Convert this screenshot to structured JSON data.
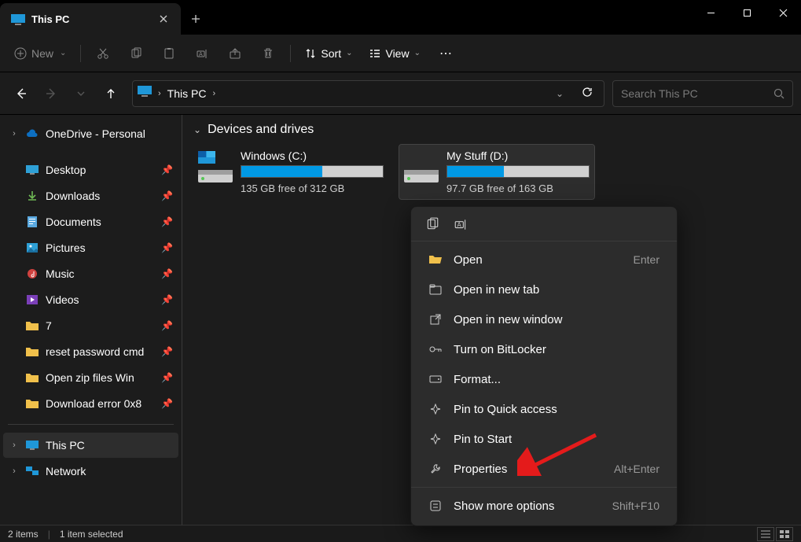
{
  "window": {
    "tab_title": "This PC",
    "search_placeholder": "Search This PC"
  },
  "toolbar": {
    "new_label": "New",
    "sort_label": "Sort",
    "view_label": "View"
  },
  "breadcrumb": {
    "item1": "This PC"
  },
  "sidebar": {
    "onedrive": "OneDrive - Personal",
    "items": [
      "Desktop",
      "Downloads",
      "Documents",
      "Pictures",
      "Music",
      "Videos",
      "7",
      "reset password cmd",
      "Open zip files Win",
      "Download error 0x8"
    ],
    "this_pc": "This PC",
    "network": "Network"
  },
  "content": {
    "section_title": "Devices and drives",
    "drives": [
      {
        "name": "Windows (C:)",
        "free_text": "135 GB free of 312 GB",
        "used_pct": 57
      },
      {
        "name": "My Stuff (D:)",
        "free_text": "97.7 GB free of 163 GB",
        "used_pct": 40
      }
    ]
  },
  "context_menu": {
    "items": [
      {
        "label": "Open",
        "shortcut": "Enter"
      },
      {
        "label": "Open in new tab",
        "shortcut": ""
      },
      {
        "label": "Open in new window",
        "shortcut": ""
      },
      {
        "label": "Turn on BitLocker",
        "shortcut": ""
      },
      {
        "label": "Format...",
        "shortcut": ""
      },
      {
        "label": "Pin to Quick access",
        "shortcut": ""
      },
      {
        "label": "Pin to Start",
        "shortcut": ""
      },
      {
        "label": "Properties",
        "shortcut": "Alt+Enter"
      },
      {
        "label": "Show more options",
        "shortcut": "Shift+F10"
      }
    ]
  },
  "statusbar": {
    "items_count": "2 items",
    "selected": "1 item selected"
  }
}
